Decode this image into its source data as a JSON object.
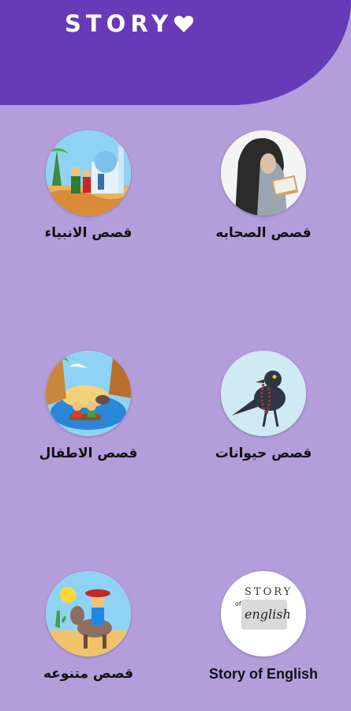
{
  "header": {
    "title": "STORY",
    "title_icon": "heart-icon",
    "bg_color": "#673ab7"
  },
  "background_color": "#b39ddb",
  "categories": [
    {
      "label": "قصص الانبياء",
      "icon": "mosque-illustration"
    },
    {
      "label": "قصص الصحابه",
      "icon": "reading-woman-illustration"
    },
    {
      "label": "قصص الاطفال",
      "icon": "island-kids-illustration"
    },
    {
      "label": "قصص حيوانات",
      "icon": "crow-illustration"
    },
    {
      "label": "قصص متنوعه",
      "icon": "donkey-rider-illustration"
    },
    {
      "label": "Story of English",
      "icon": "story-of-english-logo"
    }
  ]
}
